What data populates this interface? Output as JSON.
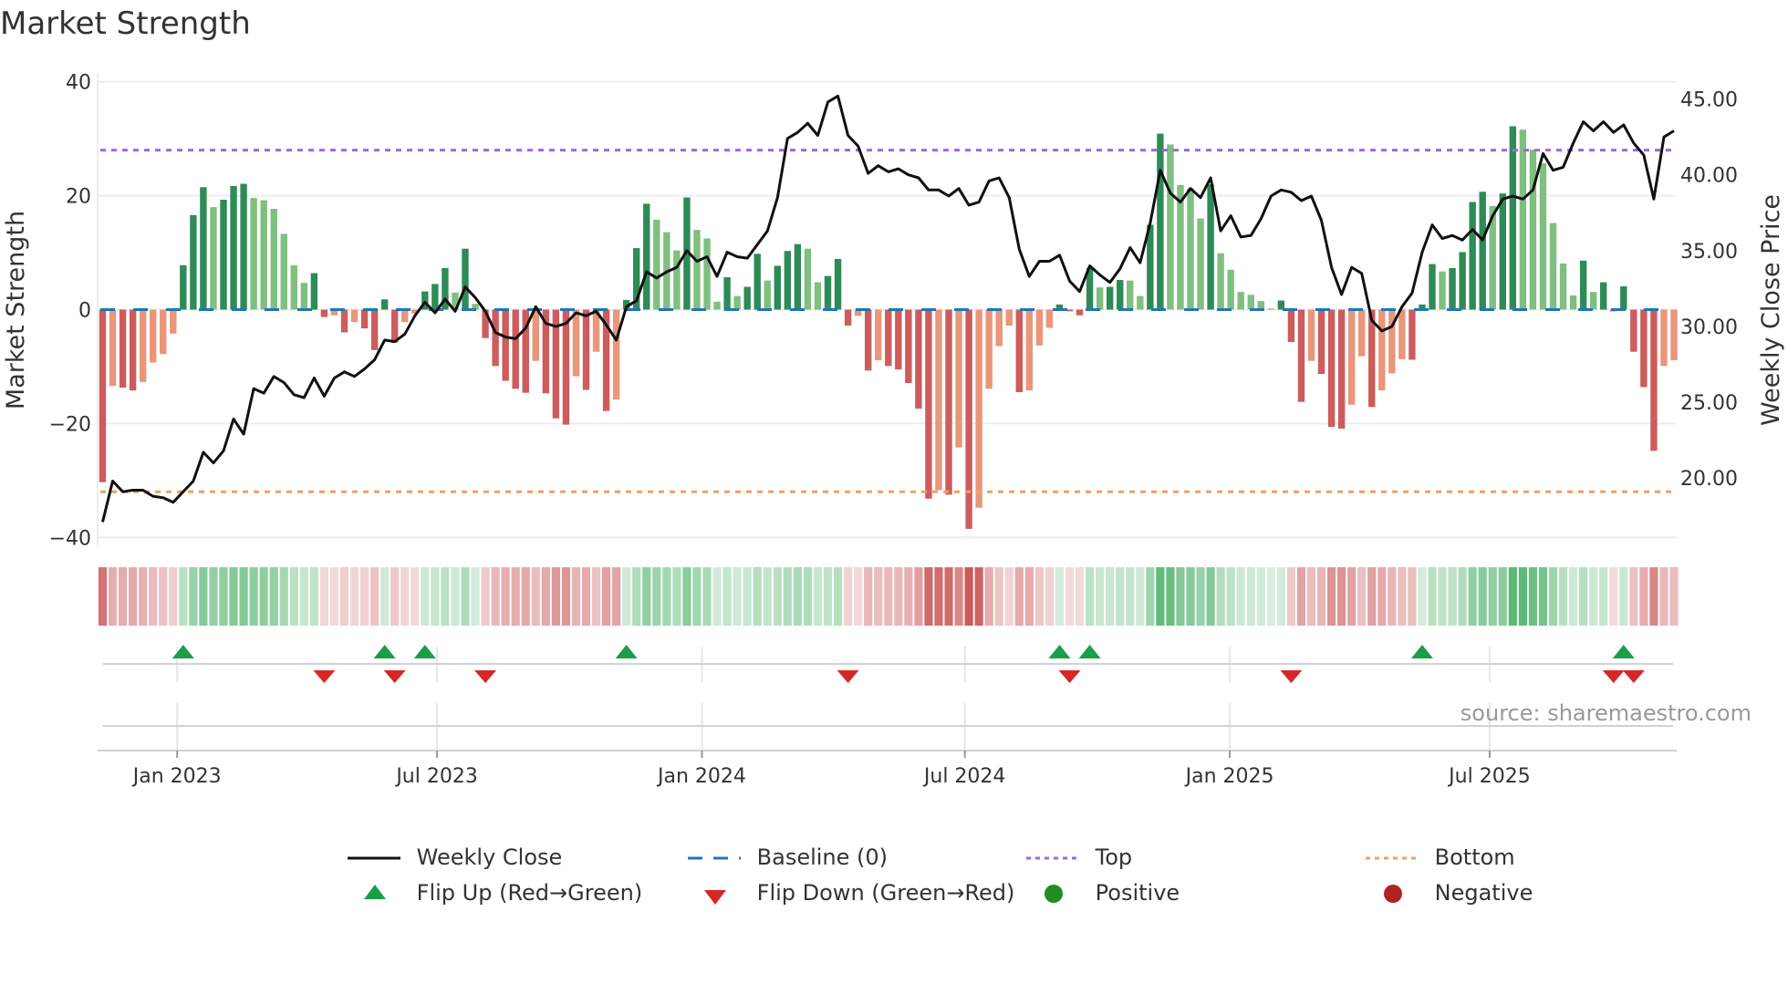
{
  "title": "Market Strength",
  "source": "source: sharemaestro.com",
  "chart_data": {
    "type": "bar",
    "title": "Market Strength",
    "ylabel": "Market Strength",
    "y2label": "Weekly Close Price",
    "ylim": [
      -41.4,
      41.4
    ],
    "y2lim": [
      15.56,
      46.66
    ],
    "yticks": [
      40,
      20,
      0,
      -20,
      -40
    ],
    "ytick_labels": [
      "40",
      "20",
      "0",
      "−20",
      "−40"
    ],
    "y2ticks": [
      45,
      40,
      35,
      30,
      25,
      20
    ],
    "y2tick_labels": [
      "45.00",
      "40.00",
      "35.00",
      "30.00",
      "25.00",
      "20.00"
    ],
    "xtick_labels": [
      "Jan 2023",
      "Jul 2023",
      "Jan 2024",
      "Jul 2024",
      "Jan 2025",
      "Jul 2025"
    ],
    "xtick_week_index": [
      7.4,
      33.2,
      59.5,
      85.6,
      111.9,
      137.7
    ],
    "top_level": 28,
    "bottom_level": -32,
    "baseline": 0,
    "grid": true,
    "legend_position": "bottom",
    "colors": {
      "pos_up": "#2e8b57",
      "pos_down": "#7fbf7f",
      "neg_down": "#cd5c5c",
      "neg_up": "#e9967a",
      "price": "#111111",
      "baseline": "#1f77b4",
      "top": "#a066e0",
      "bottom": "#f0a060",
      "flip_up": "#1a9e48",
      "flip_down": "#d62728",
      "positive": "#228b22",
      "negative": "#b22222"
    },
    "strength": [
      -30.3,
      -13.4,
      -13.7,
      -14.2,
      -12.7,
      -9.3,
      -7.8,
      -4.2,
      7.8,
      16.6,
      21.5,
      18.0,
      19.3,
      21.7,
      22.1,
      19.6,
      19.2,
      17.7,
      13.3,
      7.8,
      4.7,
      6.4,
      -1.3,
      -1.0,
      -4.0,
      -2.2,
      -3.3,
      -7.1,
      1.8,
      -5.8,
      -2.2,
      -0.7,
      3.2,
      4.5,
      7.3,
      3.0,
      10.7,
      1.0,
      -5.0,
      -9.9,
      -12.5,
      -13.9,
      -14.6,
      -9.0,
      -14.7,
      -19.1,
      -20.2,
      -11.7,
      -14.1,
      -7.4,
      -17.8,
      -15.8,
      1.7,
      10.8,
      18.6,
      15.8,
      13.6,
      10.4,
      19.7,
      14.0,
      12.5,
      1.4,
      5.7,
      2.4,
      4.0,
      9.8,
      5.1,
      7.7,
      10.3,
      11.5,
      10.7,
      4.8,
      5.9,
      8.9,
      -2.8,
      -1.1,
      -10.7,
      -8.9,
      -9.9,
      -10.5,
      -12.9,
      -17.4,
      -33.2,
      -31.7,
      -32.5,
      -24.2,
      -38.5,
      -34.8,
      -13.9,
      -6.4,
      -2.8,
      -14.5,
      -14.2,
      -6.3,
      -3.2,
      0.9,
      -0.3,
      -1.0,
      7.3,
      3.9,
      4.0,
      5.2,
      5.1,
      2.4,
      14.9,
      30.9,
      29.0,
      21.9,
      21.3,
      16.0,
      22.0,
      9.9,
      7.0,
      3.1,
      2.6,
      1.5,
      0.2,
      1.6,
      -5.7,
      -16.2,
      -9.0,
      -11.3,
      -20.6,
      -20.9,
      -16.7,
      -8.2,
      -17.1,
      -14.2,
      -11.2,
      -8.7,
      -8.8,
      0.9,
      8.0,
      6.7,
      7.3,
      10.1,
      18.9,
      20.7,
      18.2,
      20.4,
      32.2,
      31.6,
      28.1,
      25.7,
      15.2,
      8.1,
      2.5,
      8.6,
      3.1,
      4.8,
      -0.3,
      4.1,
      -7.4,
      -13.6,
      -24.8,
      -9.9,
      -8.9
    ],
    "price": [
      17.1,
      19.8,
      19.1,
      19.2,
      19.2,
      18.8,
      18.7,
      18.4,
      19.1,
      19.8,
      21.7,
      21.0,
      21.8,
      23.9,
      22.9,
      25.9,
      25.6,
      26.7,
      26.3,
      25.5,
      25.3,
      26.6,
      25.4,
      26.6,
      27.0,
      26.7,
      27.2,
      27.8,
      29.1,
      29.0,
      29.5,
      30.7,
      31.6,
      30.9,
      31.8,
      31.0,
      32.6,
      31.9,
      31.0,
      29.6,
      29.3,
      29.2,
      29.9,
      31.3,
      30.2,
      30.0,
      30.2,
      30.9,
      30.7,
      31.0,
      30.1,
      29.1,
      31.3,
      31.7,
      33.6,
      33.2,
      33.6,
      33.9,
      35.0,
      34.3,
      34.6,
      33.3,
      34.9,
      34.6,
      34.5,
      35.4,
      36.3,
      38.5,
      42.4,
      42.8,
      43.4,
      42.6,
      44.8,
      45.2,
      42.6,
      41.9,
      40.1,
      40.6,
      40.2,
      40.4,
      40.0,
      39.8,
      39.0,
      39.0,
      38.6,
      39.1,
      38.0,
      38.2,
      39.6,
      39.8,
      38.5,
      35.1,
      33.3,
      34.3,
      34.3,
      34.7,
      33.0,
      32.3,
      34.0,
      33.4,
      32.9,
      33.8,
      35.2,
      34.2,
      36.8,
      40.3,
      38.8,
      38.2,
      39.1,
      38.5,
      39.8,
      36.3,
      37.3,
      35.9,
      36.0,
      37.1,
      38.6,
      39.0,
      38.85,
      38.3,
      38.6,
      37.0,
      33.9,
      32.1,
      33.9,
      33.5,
      30.4,
      29.7,
      30.0,
      31.3,
      32.2,
      34.9,
      36.7,
      35.8,
      36.0,
      35.7,
      36.4,
      35.7,
      37.3,
      38.4,
      38.6,
      38.4,
      39.0,
      41.4,
      40.3,
      40.5,
      42.1,
      43.5,
      42.9,
      43.5,
      42.8,
      43.3,
      42.1,
      41.3,
      38.4,
      42.5,
      42.9
    ]
  },
  "legend": [
    {
      "label": "Weekly Close",
      "icon": "line-solid"
    },
    {
      "label": "Baseline (0)",
      "icon": "line-dashed"
    },
    {
      "label": "Top",
      "icon": "line-dotted"
    },
    {
      "label": "Bottom",
      "icon": "line-dotted"
    },
    {
      "label": "Flip Up (Red→Green)",
      "icon": "triangle-up"
    },
    {
      "label": "Flip Down (Green→Red)",
      "icon": "triangle-down"
    },
    {
      "label": "Positive",
      "icon": "circle"
    },
    {
      "label": "Negative",
      "icon": "circle"
    }
  ]
}
